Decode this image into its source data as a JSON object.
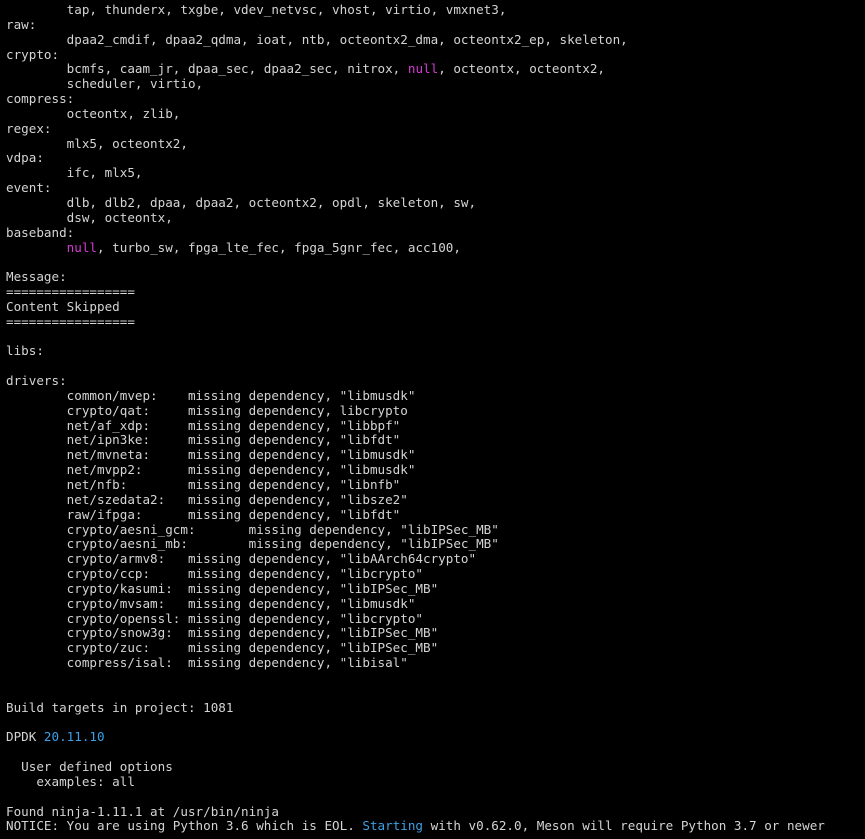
{
  "terminal": {
    "lines": [
      [
        {
          "t": "        tap, thunderx, txgbe, vdev_netvsc, vhost, virtio, vmxnet3,"
        }
      ],
      [
        {
          "t": "raw:"
        }
      ],
      [
        {
          "t": "        dpaa2_cmdif, dpaa2_qdma, ioat, ntb, octeontx2_dma, octeontx2_ep, skeleton,"
        }
      ],
      [
        {
          "t": "crypto:"
        }
      ],
      [
        {
          "t": "        bcmfs, caam_jr, dpaa_sec, dpaa2_sec, nitrox, "
        },
        {
          "t": "null",
          "c": "magenta"
        },
        {
          "t": ", octeontx, octeontx2,"
        }
      ],
      [
        {
          "t": "        scheduler, virtio,"
        }
      ],
      [
        {
          "t": "compress:"
        }
      ],
      [
        {
          "t": "        octeontx, zlib,"
        }
      ],
      [
        {
          "t": "regex:"
        }
      ],
      [
        {
          "t": "        mlx5, octeontx2,"
        }
      ],
      [
        {
          "t": "vdpa:"
        }
      ],
      [
        {
          "t": "        ifc, mlx5,"
        }
      ],
      [
        {
          "t": "event:"
        }
      ],
      [
        {
          "t": "        dlb, dlb2, dpaa, dpaa2, octeontx2, opdl, skeleton, sw,"
        }
      ],
      [
        {
          "t": "        dsw, octeontx,"
        }
      ],
      [
        {
          "t": "baseband:"
        }
      ],
      [
        {
          "t": "        "
        },
        {
          "t": "null",
          "c": "magenta"
        },
        {
          "t": ", turbo_sw, fpga_lte_fec, fpga_5gnr_fec, acc100,"
        }
      ],
      [
        {
          "t": ""
        }
      ],
      [
        {
          "t": "Message:"
        }
      ],
      [
        {
          "t": "================="
        }
      ],
      [
        {
          "t": "Content Skipped"
        }
      ],
      [
        {
          "t": "================="
        }
      ],
      [
        {
          "t": ""
        }
      ],
      [
        {
          "t": "libs:"
        }
      ],
      [
        {
          "t": ""
        }
      ],
      [
        {
          "t": "drivers:"
        }
      ],
      [
        {
          "t": "        common/mvep:    missing dependency, \"libmusdk\""
        }
      ],
      [
        {
          "t": "        crypto/qat:     missing dependency, libcrypto"
        }
      ],
      [
        {
          "t": "        net/af_xdp:     missing dependency, \"libbpf\""
        }
      ],
      [
        {
          "t": "        net/ipn3ke:     missing dependency, \"libfdt\""
        }
      ],
      [
        {
          "t": "        net/mvneta:     missing dependency, \"libmusdk\""
        }
      ],
      [
        {
          "t": "        net/mvpp2:      missing dependency, \"libmusdk\""
        }
      ],
      [
        {
          "t": "        net/nfb:        missing dependency, \"libnfb\""
        }
      ],
      [
        {
          "t": "        net/szedata2:   missing dependency, \"libsze2\""
        }
      ],
      [
        {
          "t": "        raw/ifpga:      missing dependency, \"libfdt\""
        }
      ],
      [
        {
          "t": "        crypto/aesni_gcm:       missing dependency, \"libIPSec_MB\""
        }
      ],
      [
        {
          "t": "        crypto/aesni_mb:        missing dependency, \"libIPSec_MB\""
        }
      ],
      [
        {
          "t": "        crypto/armv8:   missing dependency, \"libAArch64crypto\""
        }
      ],
      [
        {
          "t": "        crypto/ccp:     missing dependency, \"libcrypto\""
        }
      ],
      [
        {
          "t": "        crypto/kasumi:  missing dependency, \"libIPSec_MB\""
        }
      ],
      [
        {
          "t": "        crypto/mvsam:   missing dependency, \"libmusdk\""
        }
      ],
      [
        {
          "t": "        crypto/openssl: missing dependency, \"libcrypto\""
        }
      ],
      [
        {
          "t": "        crypto/snow3g:  missing dependency, \"libIPSec_MB\""
        }
      ],
      [
        {
          "t": "        crypto/zuc:     missing dependency, \"libIPSec_MB\""
        }
      ],
      [
        {
          "t": "        compress/isal:  missing dependency, \"libisal\""
        }
      ],
      [
        {
          "t": ""
        }
      ],
      [
        {
          "t": ""
        }
      ],
      [
        {
          "t": "Build targets in project: 1081"
        }
      ],
      [
        {
          "t": ""
        }
      ],
      [
        {
          "t": "DPDK "
        },
        {
          "t": "20.11.10",
          "c": "cyan"
        }
      ],
      [
        {
          "t": ""
        }
      ],
      [
        {
          "t": "  User defined options"
        }
      ],
      [
        {
          "t": "    examples: all"
        }
      ],
      [
        {
          "t": ""
        }
      ],
      [
        {
          "t": "Found ninja-1.11.1 at /usr/bin/ninja"
        }
      ],
      [
        {
          "t": "NOTICE: You are using Python 3.6 which is EOL. "
        },
        {
          "t": "Starting",
          "c": "cyan"
        },
        {
          "t": " with v0.62.0, Meson will require Python 3.7 or newer"
        }
      ]
    ]
  }
}
